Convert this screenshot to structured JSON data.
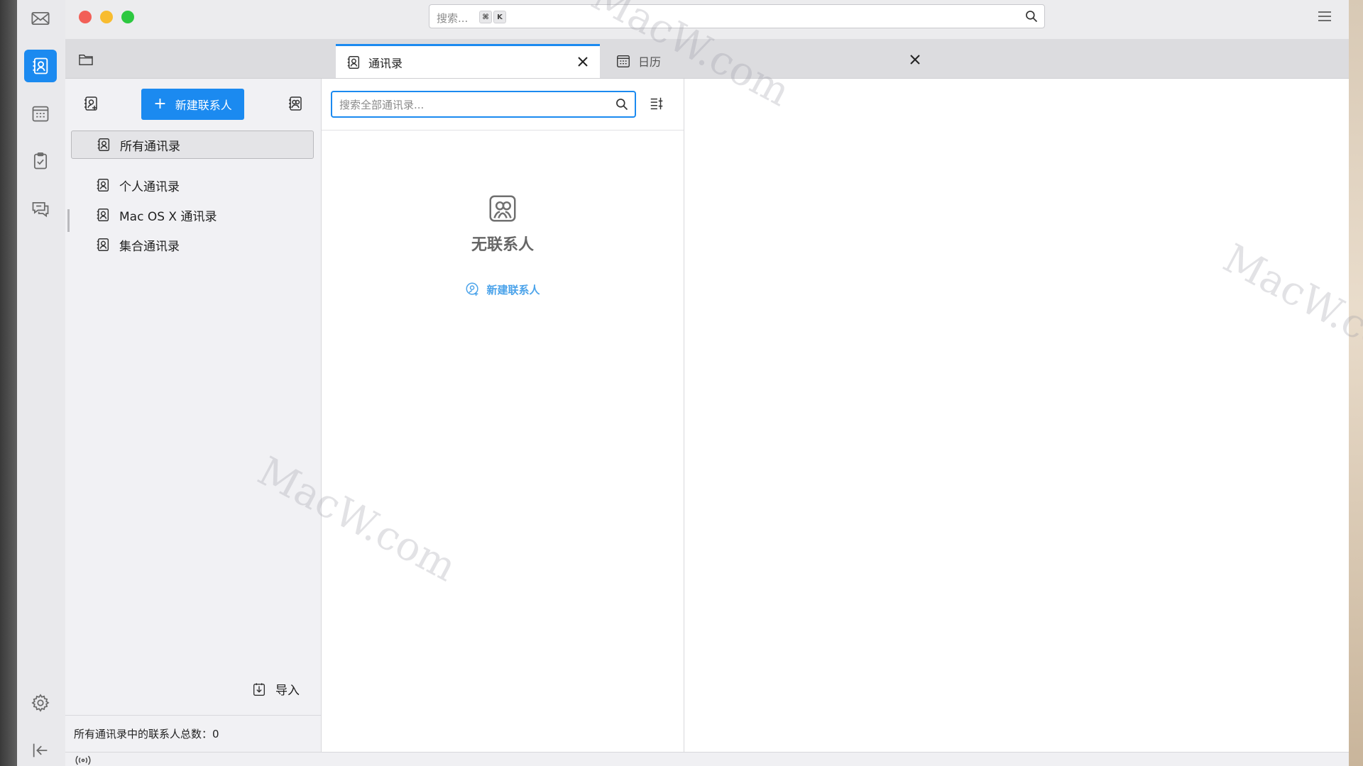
{
  "global_search": {
    "placeholder": "搜索...",
    "shortcut_keys": [
      "⌘",
      "K"
    ]
  },
  "spaces": [
    "mail",
    "contacts",
    "calendar",
    "tasks",
    "chat",
    "settings",
    "collapse"
  ],
  "tabs": [
    {
      "label": "通讯录",
      "icon": "address-book-icon",
      "active": true
    },
    {
      "label": "日历",
      "icon": "calendar-icon",
      "active": false
    }
  ],
  "sidebar": {
    "new_contact_label": "新建联系人",
    "address_books": [
      {
        "label": "所有通讯录",
        "selected": true
      },
      {
        "label": "个人通讯录",
        "selected": false
      },
      {
        "label": "Mac OS X 通讯录",
        "selected": false
      },
      {
        "label": "集合通讯录",
        "selected": false
      }
    ],
    "import_label": "导入",
    "footer_text": "所有通讯录中的联系人总数：0"
  },
  "list": {
    "search_placeholder": "搜索全部通讯录..."
  },
  "empty_state": {
    "title": "无联系人",
    "link_label": "新建联系人"
  },
  "watermark": "MacW.com",
  "colors": {
    "accent": "#1b8af0",
    "link": "#4ba3ea"
  }
}
